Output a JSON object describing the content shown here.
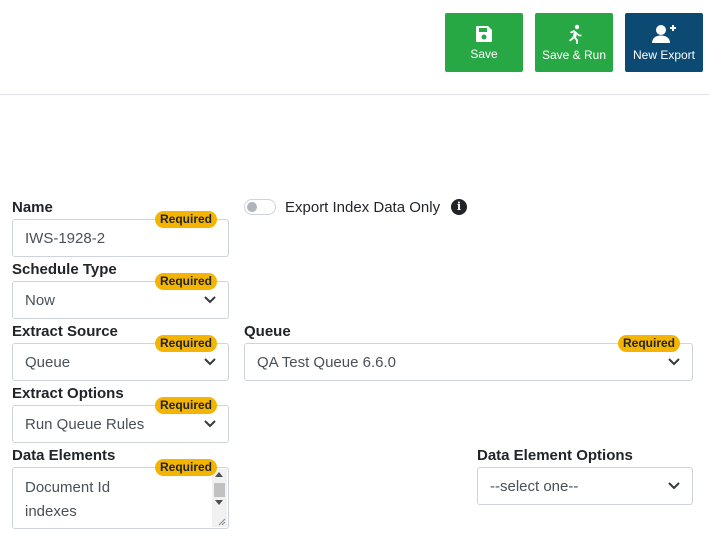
{
  "toolbar": {
    "save_label": "Save",
    "save_run_label": "Save & Run",
    "new_export_label": "New Export"
  },
  "form": {
    "required_badge": "Required",
    "name": {
      "label": "Name",
      "value": "IWS-1928-2"
    },
    "export_index_only": {
      "label": "Export Index Data Only",
      "checked": false
    },
    "schedule_type": {
      "label": "Schedule Type",
      "value": "Now"
    },
    "extract_source": {
      "label": "Extract Source",
      "value": "Queue"
    },
    "queue": {
      "label": "Queue",
      "value": "QA Test Queue 6.6.0"
    },
    "extract_options": {
      "label": "Extract Options",
      "value": "Run Queue Rules"
    },
    "data_elements": {
      "label": "Data Elements",
      "items": [
        "Document Id",
        "indexes"
      ]
    },
    "data_element_options": {
      "label": "Data Element Options",
      "value": "--select one--"
    }
  },
  "icons": {
    "save": "floppy-disk-icon",
    "save_run": "running-person-icon",
    "new_export": "user-plus-icon",
    "info": "info-circle-icon",
    "chevron": "chevron-down-icon"
  },
  "colors": {
    "green": "#28a745",
    "dark_blue": "#0d4a73",
    "required_badge": "#f4b400"
  }
}
